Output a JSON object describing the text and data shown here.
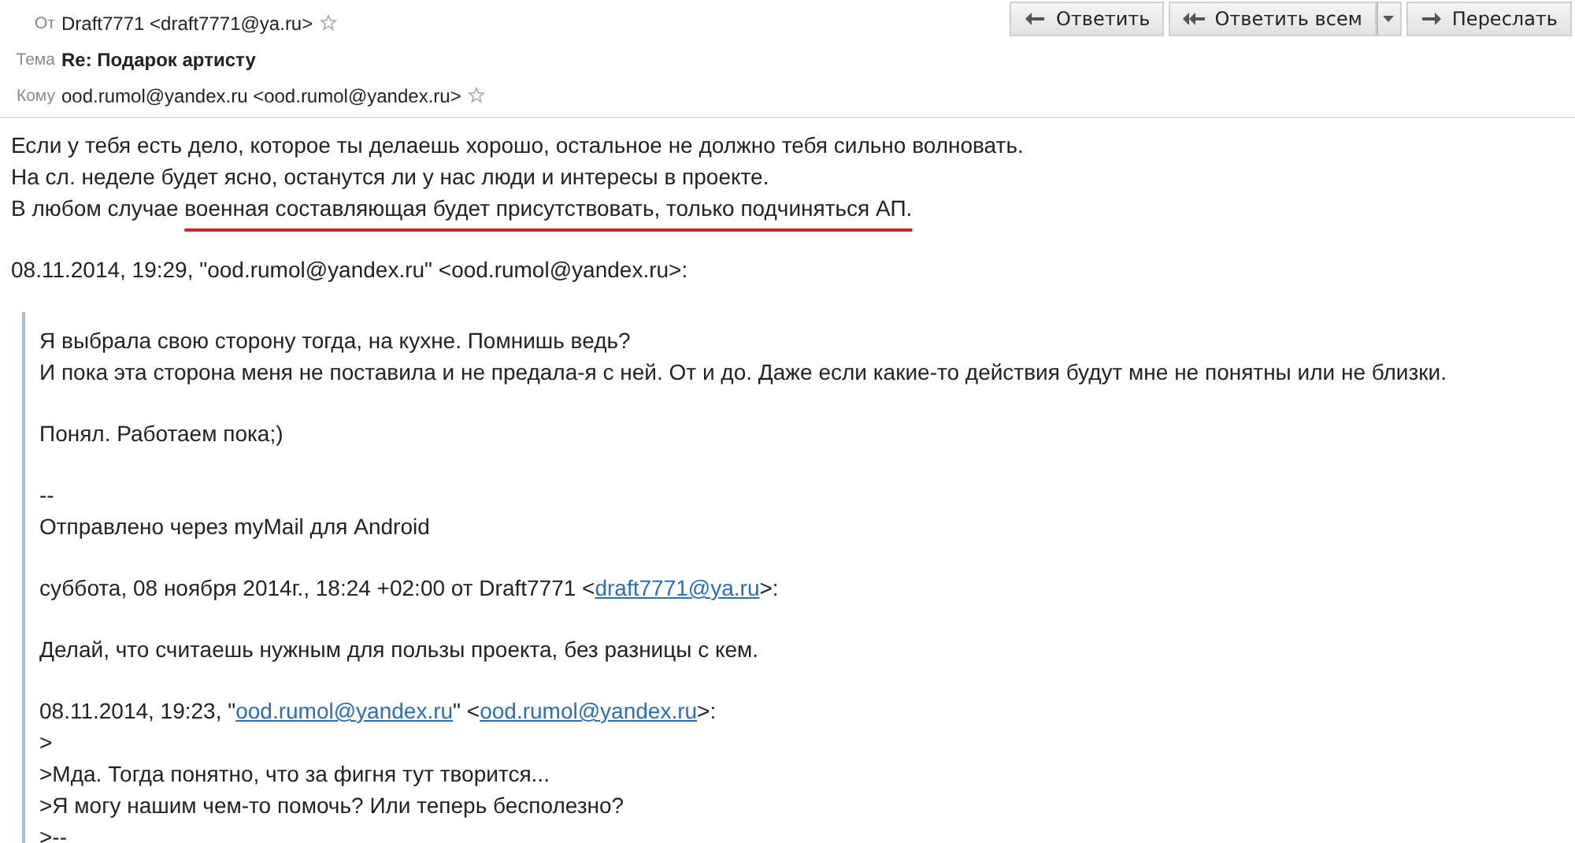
{
  "header": {
    "fields": [
      {
        "label": "От",
        "value": "Draft7771 <draft7771@ya.ru>",
        "bold": false,
        "star": true
      },
      {
        "label": "Тема",
        "value": "Re: Подарок артисту",
        "bold": true,
        "star": false
      },
      {
        "label": "Кому",
        "value": "ood.rumol@yandex.ru <ood.rumol@yandex.ru>",
        "bold": false,
        "star": true
      }
    ],
    "buttons": [
      {
        "label": "Ответить",
        "kind": "reply"
      },
      {
        "label": "Ответить всем",
        "kind": "reply-all"
      },
      {
        "label": "Переслать",
        "kind": "forward"
      }
    ]
  },
  "body": [
    {
      "lines": [
        [
          {
            "kind": "text",
            "text": "Если у тебя есть дело, которое ты делаешь хорошо, остальное не должно тебя сильно волновать."
          }
        ],
        [
          {
            "kind": "text",
            "text": "На сл. неделе будет ясно, останутся ли у нас люди и интересы в проекте."
          }
        ],
        [
          {
            "kind": "text",
            "text": "В любом случае "
          },
          {
            "kind": "underlined",
            "text": "военная составляющая будет присутствовать, только подчиняться АП."
          }
        ]
      ]
    },
    {
      "lines": [
        [
          {
            "kind": "text",
            "text": "08.11.2014, 19:29, \"ood.rumol@yandex.ru\" <ood.rumol@yandex.ru>:"
          }
        ]
      ]
    }
  ],
  "quote": [
    {
      "lines": [
        [
          {
            "kind": "text",
            "text": "Я выбрала свою сторону тогда, на кухне. Помнишь ведь?"
          }
        ],
        [
          {
            "kind": "text",
            "text": "И пока эта сторона меня не поставила и не предала-я с ней. От и до. Даже если какие-то действия будут мне не понятны или не близки."
          }
        ]
      ]
    },
    {
      "lines": [
        [
          {
            "kind": "text",
            "text": "Понял. Работаем пока;)"
          }
        ]
      ]
    },
    {
      "lines": [
        [
          {
            "kind": "text",
            "text": "--"
          }
        ],
        [
          {
            "kind": "text",
            "text": "Отправлено через myMail для Android"
          }
        ]
      ]
    },
    {
      "lines": [
        [
          {
            "kind": "text",
            "text": "суббота, 08 ноября 2014г., 18:24 +02:00 от Draft7771 <"
          },
          {
            "kind": "link",
            "text": "draft7771@ya.ru"
          },
          {
            "kind": "text",
            "text": ">:"
          }
        ]
      ]
    },
    {
      "lines": [
        [
          {
            "kind": "text",
            "text": "Делай, что считаешь нужным для пользы проекта, без разницы с кем."
          }
        ]
      ]
    },
    {
      "lines": [
        [
          {
            "kind": "text",
            "text": "08.11.2014, 19:23, \""
          },
          {
            "kind": "link",
            "text": "ood.rumol@yandex.ru"
          },
          {
            "kind": "text",
            "text": "\" <"
          },
          {
            "kind": "link",
            "text": "ood.rumol@yandex.ru"
          },
          {
            "kind": "text",
            "text": ">:"
          }
        ],
        [
          {
            "kind": "text",
            "text": ">"
          }
        ],
        [
          {
            "kind": "text",
            "text": ">Мда. Тогда понятно, что за фигня тут творится..."
          }
        ],
        [
          {
            "kind": "text",
            "text": ">Я могу нашим чем-то помочь?  Или теперь бесполезно?"
          }
        ],
        [
          {
            "kind": "text",
            "text": ">--"
          }
        ]
      ]
    }
  ]
}
